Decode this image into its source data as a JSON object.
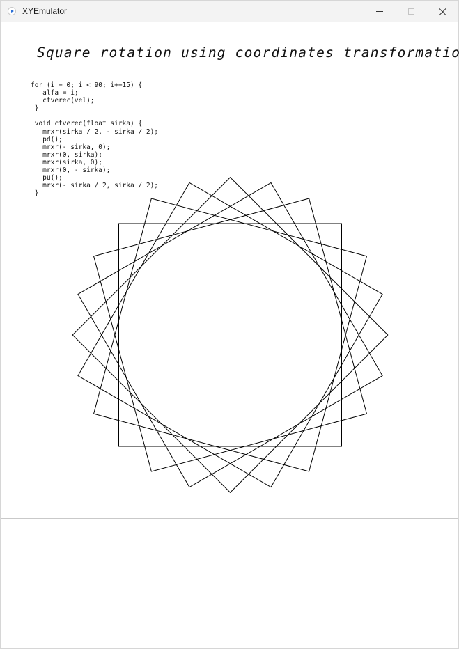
{
  "window": {
    "title": "XYEmulator",
    "app_icon": "play-icon",
    "controls": [
      "minimize-icon",
      "maximize-icon",
      "close-icon"
    ]
  },
  "canvas": {
    "heading": "Square rotation using coordinates transformation:",
    "code_lines": [
      "for (i = 0; i < 90; i+=15) {",
      "   alfa = i;",
      "   ctverec(vel);",
      " }",
      "",
      " void ctverec(float sirka) {",
      "   mrxr(sirka / 2, - sirka / 2);",
      "   pd();",
      "   mrxr(- sirka, 0);",
      "   mrxr(0, sirka);",
      "   mrxr(sirka, 0);",
      "   mrxr(0, - sirka);",
      "   pu();",
      "   mrxr(- sirka / 2, sirka / 2);",
      " }"
    ],
    "drawing": {
      "rotation_angles_deg": [
        0,
        15,
        30,
        45,
        60,
        75
      ],
      "stroke_color": "#000000"
    }
  }
}
